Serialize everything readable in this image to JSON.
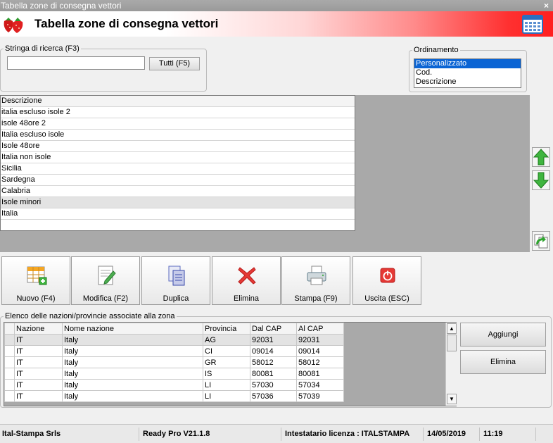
{
  "window": {
    "title": "Tabella zone di consegna vettori",
    "close_label": "×"
  },
  "header": {
    "title": "Tabella zone di consegna vettori",
    "logo_icon": "strawberry-icon",
    "calendar_icon": "calendar-icon"
  },
  "search": {
    "legend": "Stringa di ricerca (F3)",
    "value": "",
    "all_button": "Tutti (F5)"
  },
  "sort": {
    "legend": "Ordinamento",
    "options": [
      "Personalizzato",
      "Cod.",
      "Descrizione"
    ],
    "selected": "Personalizzato"
  },
  "zones": {
    "header": "Descrizione",
    "rows": [
      "italia escluso isole 2",
      "isole 48ore 2",
      "Italia escluso isole",
      "Isole 48ore",
      "Italia non isole",
      "Sicilia",
      "Sardegna",
      "Calabria",
      "Isole minori",
      "Italia"
    ],
    "highlighted": "Isole minori"
  },
  "side_buttons": {
    "up_icon": "arrow-up-icon",
    "down_icon": "arrow-down-icon",
    "refresh_icon": "refresh-icon"
  },
  "toolbar": {
    "new_label": "Nuovo (F4)",
    "edit_label": "Modifica (F2)",
    "duplicate_label": "Duplica",
    "delete_label": "Elimina",
    "print_label": "Stampa (F9)",
    "exit_label": "Uscita (ESC)"
  },
  "nations": {
    "legend": "Elenco delle nazioni/provincie associate alla zona",
    "columns": [
      "Nazione",
      "Nome nazione",
      "Provincia",
      "Dal CAP",
      "Al CAP"
    ],
    "rows": [
      [
        "IT",
        "Italy",
        "AG",
        "92031",
        "92031"
      ],
      [
        "IT",
        "Italy",
        "CI",
        "09014",
        "09014"
      ],
      [
        "IT",
        "Italy",
        "GR",
        "58012",
        "58012"
      ],
      [
        "IT",
        "Italy",
        "IS",
        "80081",
        "80081"
      ],
      [
        "IT",
        "Italy",
        "LI",
        "57030",
        "57034"
      ],
      [
        "IT",
        "Italy",
        "LI",
        "57036",
        "57039"
      ]
    ],
    "add_button": "Aggiungi",
    "delete_button": "Elimina"
  },
  "status": {
    "company": "Ital-Stampa Srls",
    "version": "Ready Pro V21.1.8",
    "license": "Intestatario licenza : ITALSTAMPA",
    "date": "14/05/2019",
    "time": "11:19"
  }
}
